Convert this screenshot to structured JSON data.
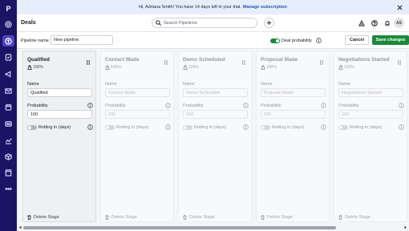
{
  "app": {
    "logo_letter": "P"
  },
  "colors": {
    "rail": "#1b1464",
    "rail_active": "#4d44c5",
    "accent_green": "#1a8a3a",
    "banner_bg": "#e6eefb",
    "link": "#1e5ab6"
  },
  "rail": {
    "items": [
      {
        "name": "target-icon"
      },
      {
        "name": "deals-icon",
        "active": true
      },
      {
        "name": "tasks-icon"
      },
      {
        "name": "campaigns-icon"
      },
      {
        "name": "mail-icon"
      },
      {
        "name": "calendar-icon"
      },
      {
        "name": "contacts-icon"
      },
      {
        "name": "insights-icon"
      },
      {
        "name": "products-icon"
      },
      {
        "name": "marketplace-icon"
      },
      {
        "name": "more-icon"
      }
    ]
  },
  "banner": {
    "message": "Hi, Adriana Smith! You have 14 days left in your trial.",
    "link": "Manage subscription"
  },
  "header": {
    "title": "Deals",
    "search_placeholder": "Search Pipedrive",
    "avatar_initials": "AS"
  },
  "toolbar": {
    "pipeline_name_label": "Pipeline name",
    "pipeline_name_value": "New pipeline",
    "deal_probability_label": "Deal probability",
    "deal_probability_on": true,
    "cancel_label": "Cancel",
    "save_label": "Save changes",
    "more_label": "⋯"
  },
  "labels": {
    "name": "Name",
    "probability": "Probability",
    "rotting": "Rotting in (days)",
    "delete_stage": "Delete Stage"
  },
  "stages": [
    {
      "title": "Qualified",
      "probability_display": "100%",
      "name_value": "Qualified",
      "probability_value": "100",
      "rotting_on": false,
      "dim": false
    },
    {
      "title": "Contact Made",
      "probability_display": "100%",
      "name_placeholder": "Contact Made",
      "probability_placeholder": "100",
      "rotting_on": false,
      "dim": true
    },
    {
      "title": "Demo Scheduled",
      "probability_display": "100%",
      "name_placeholder": "Demo Scheduled",
      "probability_placeholder": "100",
      "rotting_on": false,
      "dim": true
    },
    {
      "title": "Proposal Made",
      "probability_display": "100%",
      "name_placeholder": "Proposal Made",
      "probability_placeholder": "100",
      "rotting_on": false,
      "dim": true
    },
    {
      "title": "Negotiations Started",
      "probability_display": "100%",
      "name_placeholder": "Negotiations Started",
      "probability_placeholder": "100",
      "rotting_on": false,
      "dim": true
    }
  ]
}
